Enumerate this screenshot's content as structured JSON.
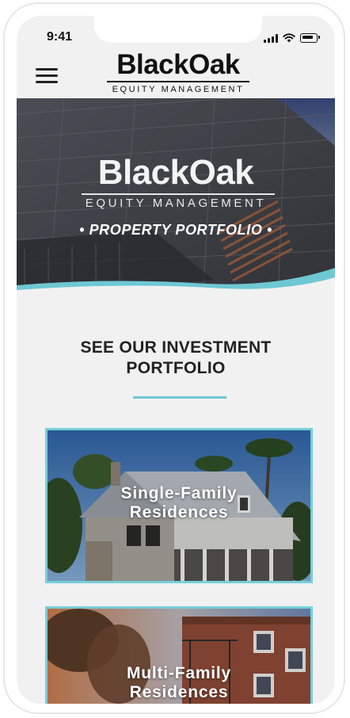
{
  "status_bar": {
    "time": "9:41"
  },
  "header": {
    "logo_title": "BlackOak",
    "logo_subtitle": "EQUITY MANAGEMENT"
  },
  "hero": {
    "title": "BlackOak",
    "subtitle": "EQUITY MANAGEMENT",
    "tagline": "• PROPERTY PORTFOLIO •"
  },
  "section": {
    "title_line1": "SEE OUR INVESTMENT",
    "title_line2": "PORTFOLIO"
  },
  "cards": [
    {
      "line1": "Single-Family",
      "line2": "Residences"
    },
    {
      "line1": "Multi-Family",
      "line2": "Residences"
    }
  ],
  "colors": {
    "accent": "#6ec8d3",
    "background": "#f1f1f2",
    "text": "#222222"
  }
}
